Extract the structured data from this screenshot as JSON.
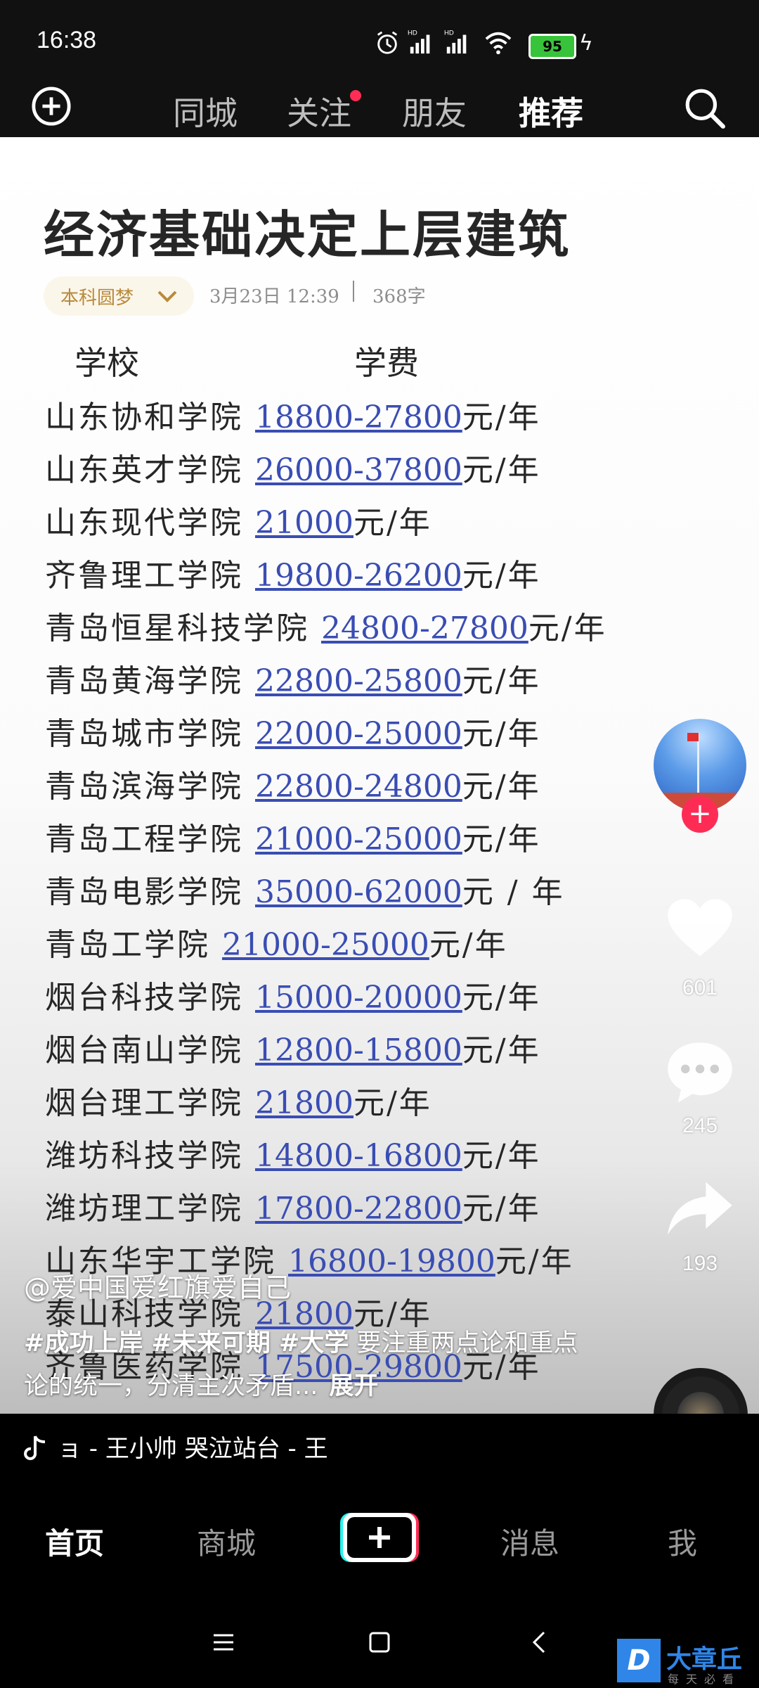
{
  "status_bar": {
    "time": "16:38",
    "battery": "95",
    "icons": [
      "alarm-icon",
      "signal-hd-1-icon",
      "signal-hd-2-icon",
      "wifi-icon",
      "battery-icon",
      "charging-icon"
    ]
  },
  "top_nav": {
    "tabs": [
      {
        "label": "同城",
        "active": false
      },
      {
        "label": "关注",
        "active": false,
        "badge": "dot"
      },
      {
        "label": "朋友",
        "active": false
      },
      {
        "label": "推荐",
        "active": true
      }
    ]
  },
  "article": {
    "title": "经济基础决定上层建筑",
    "author": "本科圆梦",
    "date": "3月23日 12:39",
    "word_count": "368字",
    "table": {
      "headers": [
        "学校",
        "学费"
      ],
      "rows": [
        {
          "school": "山东协和学院 ",
          "fee": "18800-27800",
          "unit": "元/年"
        },
        {
          "school": "山东英才学院 ",
          "fee": "26000-37800",
          "unit": "元/年"
        },
        {
          "school": "山东现代学院 ",
          "fee": "21000",
          "unit": "元/年"
        },
        {
          "school": "齐鲁理工学院 ",
          "fee": "19800-26200",
          "unit": "元/年"
        },
        {
          "school": "青岛恒星科技学院 ",
          "fee": "24800-27800",
          "unit": "元/年"
        },
        {
          "school": "青岛黄海学院 ",
          "fee": "22800-25800",
          "unit": "元/年"
        },
        {
          "school": "青岛城市学院 ",
          "fee": "22000-25000",
          "unit": "元/年"
        },
        {
          "school": "青岛滨海学院 ",
          "fee": "22800-24800",
          "unit": "元/年"
        },
        {
          "school": "青岛工程学院 ",
          "fee": "21000-25000",
          "unit": "元/年"
        },
        {
          "school": "青岛电影学院 ",
          "fee": "35000-62000",
          "unit": "元 / 年"
        },
        {
          "school": "青岛工学院 ",
          "fee": "21000-25000",
          "unit": "元/年"
        },
        {
          "school": "烟台科技学院 ",
          "fee": "15000-20000",
          "unit": "元/年"
        },
        {
          "school": "烟台南山学院 ",
          "fee": "12800-15800",
          "unit": "元/年"
        },
        {
          "school": "烟台理工学院 ",
          "fee": "21800",
          "unit": "元/年"
        },
        {
          "school": "潍坊科技学院 ",
          "fee": "14800-16800",
          "unit": "元/年"
        },
        {
          "school": "潍坊理工学院 ",
          "fee": "17800-22800",
          "unit": "元/年"
        },
        {
          "school": "山东华宇工学院 ",
          "fee": "16800-19800",
          "unit": "元/年"
        },
        {
          "school": "泰山科技学院 ",
          "fee": "21800",
          "unit": "元/年"
        },
        {
          "school": "齐鲁医药学院 ",
          "fee": "17500-29800",
          "unit": "元/年"
        }
      ]
    }
  },
  "right_rail": {
    "follow_label": "+",
    "likes": "601",
    "comments": "245",
    "shares": "193"
  },
  "caption": {
    "user": "@爱中国爱红旗爱自己",
    "tags": "#成功上岸 #未来可期 #大学",
    "text": " 要注重两点论和重点论的统一，分清主次矛盾...",
    "expand": "展开"
  },
  "music": {
    "text": "ョ - 王小帅    哭泣站台 - 王"
  },
  "bottom_nav": {
    "items": [
      {
        "label": "首页",
        "active": true
      },
      {
        "label": "商城",
        "active": false
      },
      {
        "label": "消息",
        "active": false
      },
      {
        "label": "我",
        "active": false
      }
    ],
    "create_label": "+"
  },
  "watermark": {
    "logo": "D",
    "name": "大章丘",
    "sub": "每天必看"
  },
  "colors": {
    "accent_red": "#fe2c55",
    "link_blue": "#3a4db3",
    "author_gold": "#b98a3c"
  }
}
